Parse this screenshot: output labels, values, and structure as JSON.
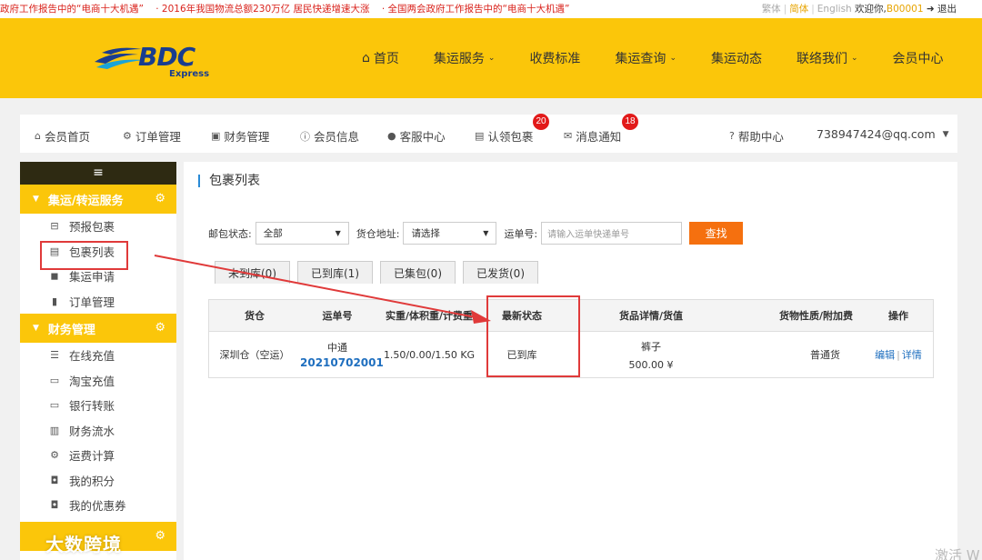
{
  "topbar": {
    "ticker": [
      "政府工作报告中的“电商十大机遇”",
      "· 2016年我国物流总额230万亿 居民快递增速大涨",
      "· 全国两会政府工作报告中的“电商十大机遇”"
    ],
    "lang_traditional": "繁体",
    "lang_simplified": "简体",
    "lang_english": "English",
    "welcome": "欢迎你,",
    "user_code": "B00001",
    "logout": "退出"
  },
  "logo": {
    "brand": "BDC",
    "sub": "Express"
  },
  "mainnav": [
    {
      "label": "首页",
      "icon": "home-icon",
      "has_dropdown": false
    },
    {
      "label": "集运服务",
      "has_dropdown": true
    },
    {
      "label": "收费标准",
      "has_dropdown": false
    },
    {
      "label": "集运查询",
      "has_dropdown": true
    },
    {
      "label": "集运动态",
      "has_dropdown": false
    },
    {
      "label": "联络我们",
      "has_dropdown": true
    },
    {
      "label": "会员中心",
      "has_dropdown": false
    }
  ],
  "membernav": {
    "home": "会员首页",
    "orders": "订单管理",
    "finance": "财务管理",
    "info": "会员信息",
    "service": "客服中心",
    "claim": "认领包裹",
    "claim_badge": "20",
    "messages": "消息通知",
    "messages_badge": "18",
    "help": "帮助中心",
    "account": "738947424@qq.com"
  },
  "sidebar": {
    "toggle": "≡",
    "sections": [
      {
        "title": "集运/转运服务",
        "items": [
          "预报包裹",
          "包裹列表",
          "集运申请",
          "订单管理"
        ]
      },
      {
        "title": "财务管理",
        "items": [
          "在线充值",
          "淘宝充值",
          "银行转账",
          "财务流水",
          "运费计算",
          "我的积分",
          "我的优惠券"
        ]
      }
    ]
  },
  "content": {
    "title": "包裹列表",
    "filters": {
      "status_label": "邮包状态:",
      "status_value": "全部",
      "warehouse_label": "货仓地址:",
      "warehouse_value": "请选择",
      "waybill_label": "运单号:",
      "waybill_placeholder": "请输入运单快递单号",
      "search_button": "查找"
    },
    "tabs": [
      "未到库(0)",
      "已到库(1)",
      "已集包(0)",
      "已发货(0)"
    ],
    "table": {
      "headers": [
        "货仓",
        "运单号",
        "实重/体积重/计费重",
        "最新状态",
        "货品详情/货值",
        "货物性质/附加费",
        "操作"
      ],
      "rows": [
        {
          "warehouse": "深圳仓（空运）",
          "carrier": "中通",
          "waybill": "20210702001",
          "weights": "1.50/0.00/1.50 KG",
          "status": "已到库",
          "item_name": "裤子",
          "item_value": "500.00 ¥",
          "nature": "普通货",
          "edit": "编辑",
          "detail": "详情"
        }
      ]
    }
  },
  "watermark": "大数跨境",
  "activate_text": "激活 W",
  "colors": {
    "brand_yellow": "#fbc60a",
    "search_orange": "#f5700f",
    "link_blue": "#1f6fbf",
    "badge_red": "#e21a1a",
    "annotation_red": "#e03a3a"
  }
}
